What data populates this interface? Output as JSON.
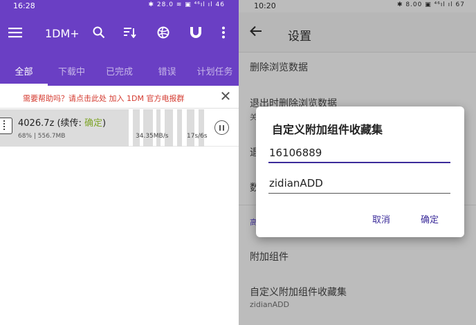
{
  "left": {
    "statusbar": {
      "time": "16:28",
      "icons": "✱ 28.0 ≋ ▣ ⁴⁶ıl ıl 46"
    },
    "toolbar": {
      "title": "1DM+",
      "icons": [
        "menu-icon",
        "search-icon",
        "sort-icon",
        "browser-icon",
        "magnet-icon",
        "more-icon"
      ]
    },
    "tabs": [
      "全部",
      "下载中",
      "已完成",
      "错误",
      "计划任务"
    ],
    "active_tab": "全部",
    "help_banner": "需要帮助吗？请点击此处 加入 1DM 官方电报群",
    "download": {
      "name": "4026.7z (续传: ",
      "status": "确定",
      "name_suffix": ")",
      "meta": "68% | 556.7MB",
      "speed": "34.35MB/s",
      "eta": "17s/6s",
      "progress": 0.68
    },
    "colors": {
      "accent": "#6a3fc4",
      "help_text": "#d43a2f",
      "status_ok": "#7fa52a"
    }
  },
  "right": {
    "statusbar": {
      "time": "10:20",
      "icons": "✱ 8.00 ▣ ⁴⁶ıl ıl 67"
    },
    "title": "设置",
    "rows": {
      "clear_history": "删除浏览数据",
      "clear_on_exit": "退出时删除浏览数据",
      "clear_on_exit_sub": "关",
      "row3": "退",
      "row4": "数",
      "section_advanced": "高",
      "addons": "附加组件",
      "custom_collection": "自定义附加组件收藏集",
      "custom_collection_value": "zidianADD"
    },
    "dialog": {
      "title": "自定义附加组件收藏集",
      "field1_value": "16106889",
      "field2_value": "zidianADD",
      "cancel": "取消",
      "ok": "确定"
    },
    "colors": {
      "accent": "#3b2b9a",
      "scrim": "#bcbcbc"
    }
  }
}
